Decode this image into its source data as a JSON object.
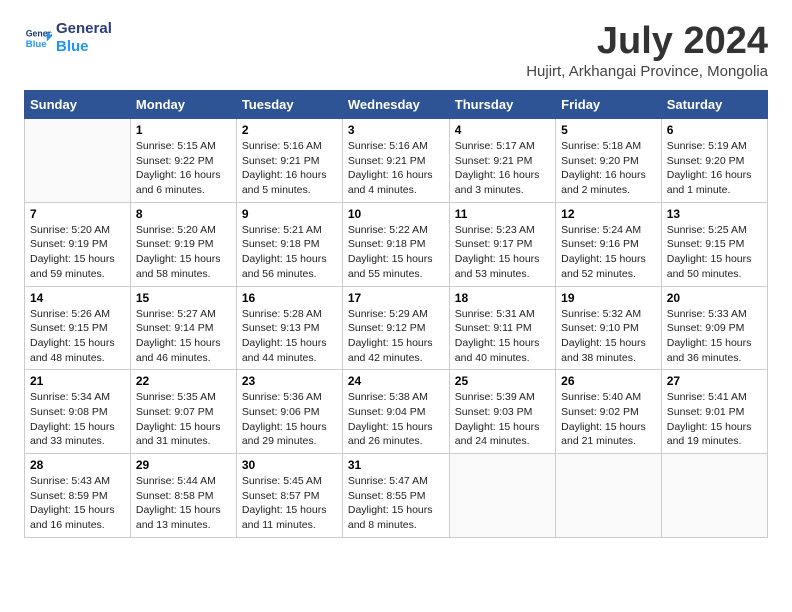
{
  "header": {
    "logo_line1": "General",
    "logo_line2": "Blue",
    "month_year": "July 2024",
    "location": "Hujirt, Arkhangai Province, Mongolia"
  },
  "weekdays": [
    "Sunday",
    "Monday",
    "Tuesday",
    "Wednesday",
    "Thursday",
    "Friday",
    "Saturday"
  ],
  "weeks": [
    [
      {
        "day": "",
        "sunrise": "",
        "sunset": "",
        "daylight": ""
      },
      {
        "day": "1",
        "sunrise": "5:15 AM",
        "sunset": "9:22 PM",
        "daylight": "16 hours and 6 minutes."
      },
      {
        "day": "2",
        "sunrise": "5:16 AM",
        "sunset": "9:21 PM",
        "daylight": "16 hours and 5 minutes."
      },
      {
        "day": "3",
        "sunrise": "5:16 AM",
        "sunset": "9:21 PM",
        "daylight": "16 hours and 4 minutes."
      },
      {
        "day": "4",
        "sunrise": "5:17 AM",
        "sunset": "9:21 PM",
        "daylight": "16 hours and 3 minutes."
      },
      {
        "day": "5",
        "sunrise": "5:18 AM",
        "sunset": "9:20 PM",
        "daylight": "16 hours and 2 minutes."
      },
      {
        "day": "6",
        "sunrise": "5:19 AM",
        "sunset": "9:20 PM",
        "daylight": "16 hours and 1 minute."
      }
    ],
    [
      {
        "day": "7",
        "sunrise": "5:20 AM",
        "sunset": "9:19 PM",
        "daylight": "15 hours and 59 minutes."
      },
      {
        "day": "8",
        "sunrise": "5:20 AM",
        "sunset": "9:19 PM",
        "daylight": "15 hours and 58 minutes."
      },
      {
        "day": "9",
        "sunrise": "5:21 AM",
        "sunset": "9:18 PM",
        "daylight": "15 hours and 56 minutes."
      },
      {
        "day": "10",
        "sunrise": "5:22 AM",
        "sunset": "9:18 PM",
        "daylight": "15 hours and 55 minutes."
      },
      {
        "day": "11",
        "sunrise": "5:23 AM",
        "sunset": "9:17 PM",
        "daylight": "15 hours and 53 minutes."
      },
      {
        "day": "12",
        "sunrise": "5:24 AM",
        "sunset": "9:16 PM",
        "daylight": "15 hours and 52 minutes."
      },
      {
        "day": "13",
        "sunrise": "5:25 AM",
        "sunset": "9:15 PM",
        "daylight": "15 hours and 50 minutes."
      }
    ],
    [
      {
        "day": "14",
        "sunrise": "5:26 AM",
        "sunset": "9:15 PM",
        "daylight": "15 hours and 48 minutes."
      },
      {
        "day": "15",
        "sunrise": "5:27 AM",
        "sunset": "9:14 PM",
        "daylight": "15 hours and 46 minutes."
      },
      {
        "day": "16",
        "sunrise": "5:28 AM",
        "sunset": "9:13 PM",
        "daylight": "15 hours and 44 minutes."
      },
      {
        "day": "17",
        "sunrise": "5:29 AM",
        "sunset": "9:12 PM",
        "daylight": "15 hours and 42 minutes."
      },
      {
        "day": "18",
        "sunrise": "5:31 AM",
        "sunset": "9:11 PM",
        "daylight": "15 hours and 40 minutes."
      },
      {
        "day": "19",
        "sunrise": "5:32 AM",
        "sunset": "9:10 PM",
        "daylight": "15 hours and 38 minutes."
      },
      {
        "day": "20",
        "sunrise": "5:33 AM",
        "sunset": "9:09 PM",
        "daylight": "15 hours and 36 minutes."
      }
    ],
    [
      {
        "day": "21",
        "sunrise": "5:34 AM",
        "sunset": "9:08 PM",
        "daylight": "15 hours and 33 minutes."
      },
      {
        "day": "22",
        "sunrise": "5:35 AM",
        "sunset": "9:07 PM",
        "daylight": "15 hours and 31 minutes."
      },
      {
        "day": "23",
        "sunrise": "5:36 AM",
        "sunset": "9:06 PM",
        "daylight": "15 hours and 29 minutes."
      },
      {
        "day": "24",
        "sunrise": "5:38 AM",
        "sunset": "9:04 PM",
        "daylight": "15 hours and 26 minutes."
      },
      {
        "day": "25",
        "sunrise": "5:39 AM",
        "sunset": "9:03 PM",
        "daylight": "15 hours and 24 minutes."
      },
      {
        "day": "26",
        "sunrise": "5:40 AM",
        "sunset": "9:02 PM",
        "daylight": "15 hours and 21 minutes."
      },
      {
        "day": "27",
        "sunrise": "5:41 AM",
        "sunset": "9:01 PM",
        "daylight": "15 hours and 19 minutes."
      }
    ],
    [
      {
        "day": "28",
        "sunrise": "5:43 AM",
        "sunset": "8:59 PM",
        "daylight": "15 hours and 16 minutes."
      },
      {
        "day": "29",
        "sunrise": "5:44 AM",
        "sunset": "8:58 PM",
        "daylight": "15 hours and 13 minutes."
      },
      {
        "day": "30",
        "sunrise": "5:45 AM",
        "sunset": "8:57 PM",
        "daylight": "15 hours and 11 minutes."
      },
      {
        "day": "31",
        "sunrise": "5:47 AM",
        "sunset": "8:55 PM",
        "daylight": "15 hours and 8 minutes."
      },
      {
        "day": "",
        "sunrise": "",
        "sunset": "",
        "daylight": ""
      },
      {
        "day": "",
        "sunrise": "",
        "sunset": "",
        "daylight": ""
      },
      {
        "day": "",
        "sunrise": "",
        "sunset": "",
        "daylight": ""
      }
    ]
  ],
  "labels": {
    "sunrise_prefix": "Sunrise: ",
    "sunset_prefix": "Sunset: ",
    "daylight_prefix": "Daylight: "
  }
}
